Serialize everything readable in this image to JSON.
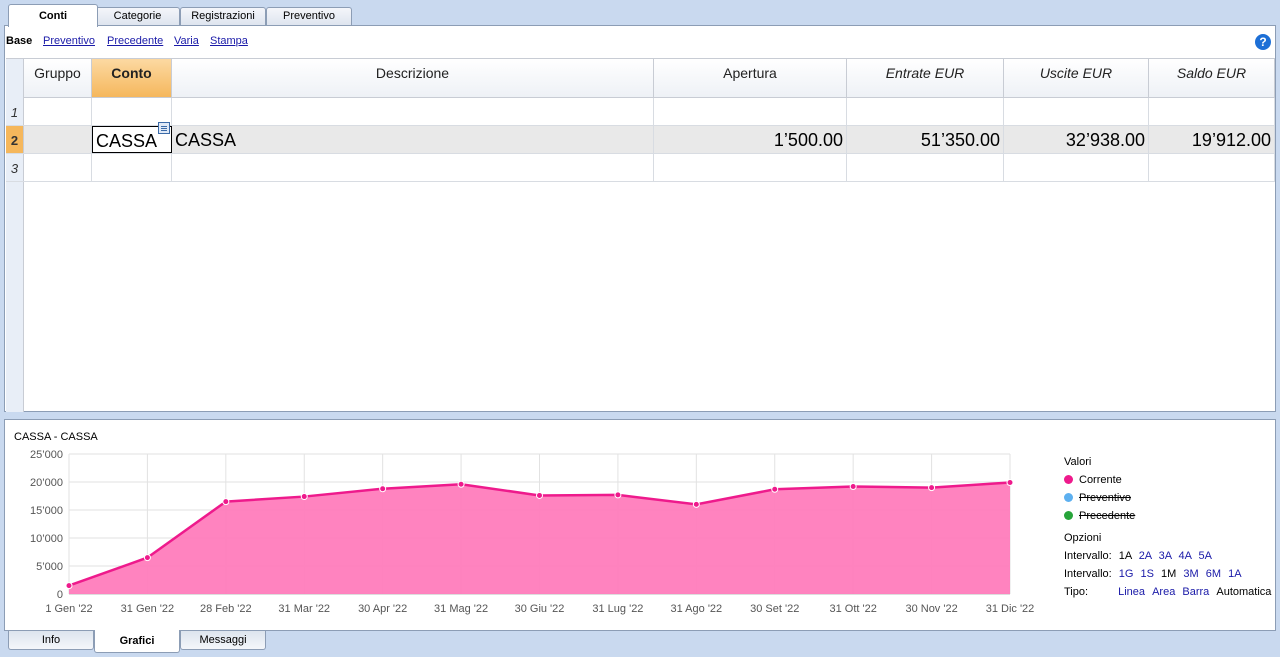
{
  "top_tabs": [
    "Conti",
    "Categorie",
    "Registrazioni",
    "Preventivo"
  ],
  "subnav": {
    "base": "Base",
    "links": [
      "Preventivo",
      "Precedente",
      "Varia",
      "Stampa"
    ]
  },
  "help_icon": "help-icon",
  "table": {
    "headers": {
      "gruppo": "Gruppo",
      "conto": "Conto",
      "descrizione": "Descrizione",
      "apertura": "Apertura",
      "entrate": "Entrate EUR",
      "uscite": "Uscite EUR",
      "saldo": "Saldo EUR"
    },
    "rows": [
      {
        "num": "1",
        "gruppo": "",
        "conto": "",
        "descrizione": "",
        "apertura": "",
        "entrate": "",
        "uscite": "",
        "saldo": ""
      },
      {
        "num": "2",
        "gruppo": "",
        "conto": "CASSA",
        "descrizione": "CASSA",
        "apertura": "1’500.00",
        "entrate": "51’350.00",
        "uscite": "32’938.00",
        "saldo": "19’912.00"
      },
      {
        "num": "3",
        "gruppo": "",
        "conto": "",
        "descrizione": "",
        "apertura": "",
        "entrate": "",
        "uscite": "",
        "saldo": ""
      }
    ]
  },
  "chart_panel": {
    "title": "CASSA - CASSA",
    "values_label": "Valori",
    "legend": [
      {
        "label": "Corrente",
        "color": "#ee1a8c",
        "strike": false
      },
      {
        "label": "Preventivo",
        "color": "#5db0f0",
        "strike": true
      },
      {
        "label": "Precedente",
        "color": "#27a43a",
        "strike": true
      }
    ],
    "options_label": "Opzioni",
    "interval1": {
      "label": "Intervallo:",
      "items": [
        "1A",
        "2A",
        "3A",
        "4A",
        "5A"
      ]
    },
    "interval2": {
      "label": "Intervallo:",
      "items": [
        "1G",
        "1S",
        "1M",
        "3M",
        "6M",
        "1A"
      ]
    },
    "tipo": {
      "label": "Tipo:",
      "items": [
        "Linea",
        "Area",
        "Barra",
        "Automatica"
      ]
    }
  },
  "chart_data": {
    "type": "area",
    "categories": [
      "1 Gen '22",
      "31 Gen '22",
      "28 Feb '22",
      "31 Mar '22",
      "30 Apr '22",
      "31 Mag '22",
      "30 Giu '22",
      "31 Lug '22",
      "31 Ago '22",
      "30 Set '22",
      "31 Ott '22",
      "30 Nov '22",
      "31 Dic '22"
    ],
    "series": [
      {
        "name": "Corrente",
        "color": "#ee1a8c",
        "values": [
          1500,
          6500,
          16500,
          17400,
          18800,
          19600,
          17600,
          17700,
          16000,
          18700,
          19200,
          19000,
          19912
        ]
      }
    ],
    "yticks": [
      "0",
      "5’000",
      "10’000",
      "15’000",
      "20’000",
      "25’000"
    ],
    "ylim": [
      0,
      25000
    ],
    "grid": true
  },
  "bottom_tabs": [
    "Info",
    "Grafici",
    "Messaggi"
  ]
}
